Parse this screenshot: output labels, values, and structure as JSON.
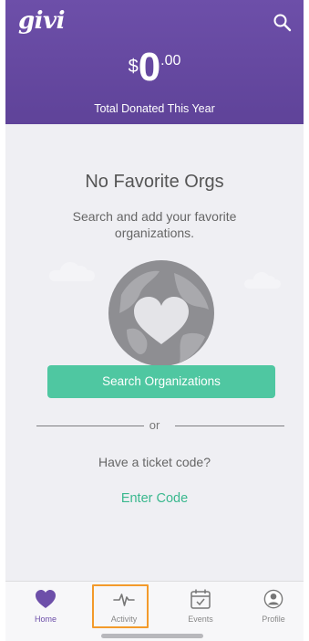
{
  "app": {
    "logo": "givi"
  },
  "header": {
    "currency": "$",
    "amount_whole": "0",
    "amount_cents": ".00",
    "total_label": "Total Donated This Year"
  },
  "empty_state": {
    "title": "No Favorite Orgs",
    "subtitle": "Search and add your favorite organizations."
  },
  "actions": {
    "search_orgs_label": "Search Organizations",
    "or_label": "or",
    "ticket_question": "Have a ticket code?",
    "enter_code_label": "Enter Code"
  },
  "tabs": [
    {
      "label": "Home",
      "icon": "heart-icon",
      "active": true
    },
    {
      "label": "Activity",
      "icon": "activity-pulse-icon",
      "active": false
    },
    {
      "label": "Events",
      "icon": "calendar-check-icon",
      "active": false
    },
    {
      "label": "Profile",
      "icon": "user-icon",
      "active": false
    }
  ],
  "colors": {
    "brand_purple": "#6d4fa9",
    "accent_green": "#4fc7a1",
    "highlight_orange": "#f39a2b"
  }
}
